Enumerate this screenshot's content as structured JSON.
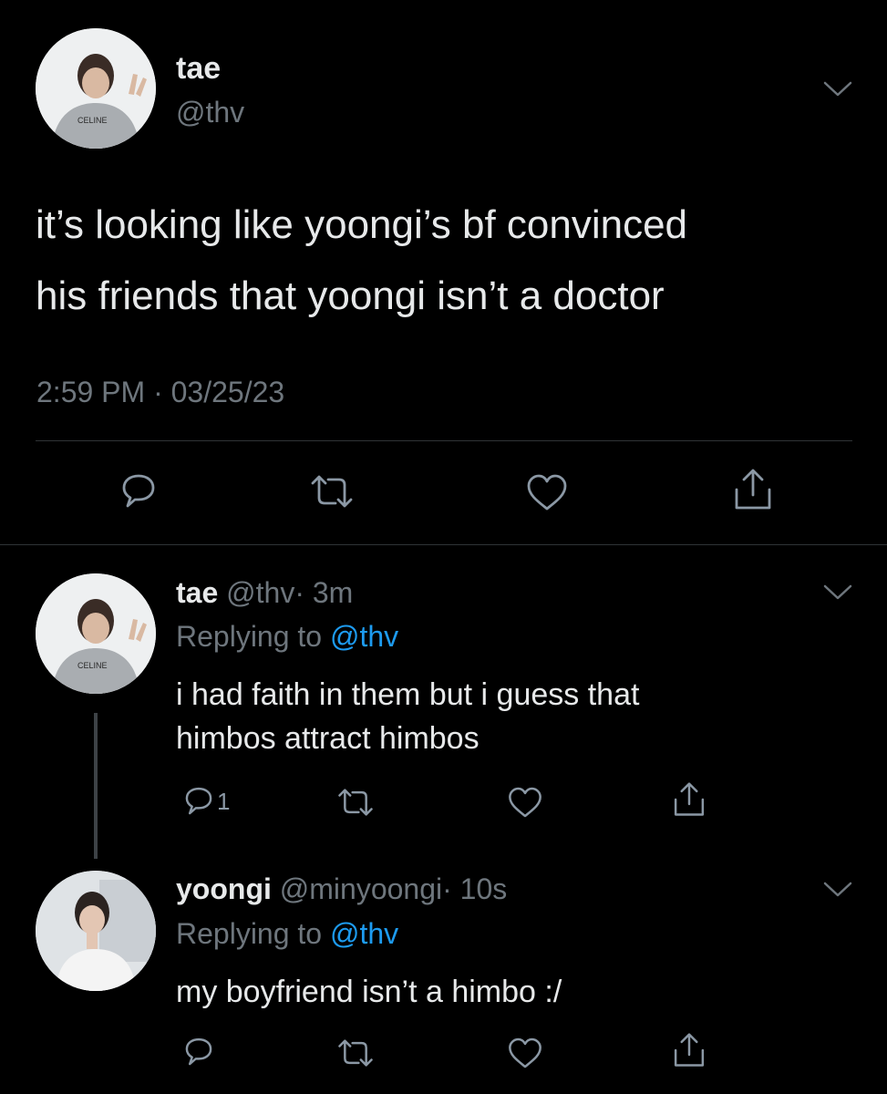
{
  "main_tweet": {
    "display_name": "tae",
    "handle": "@thv",
    "avatar_text": "CELINE",
    "text_line1": "it’s looking like yoongi’s bf convinced",
    "text_line2": "his friends that yoongi isn’t a doctor",
    "timestamp": "2:59 PM · 03/25/23"
  },
  "reply1": {
    "display_name": "tae",
    "handle": "@thv",
    "time": "· 3m",
    "replying_prefix": "Replying to",
    "replying_handle": "@thv",
    "avatar_text": "CELINE",
    "text_line1": "i had faith in them but i guess that",
    "text_line2": "himbos attract himbos",
    "reply_count": "1"
  },
  "reply2": {
    "display_name": "yoongi",
    "handle": "@minyoongi",
    "time": "· 10s",
    "replying_prefix": "Replying to",
    "replying_handle": "@thv",
    "text_line1": "my boyfriend isn’t a himbo :/"
  },
  "icons": [
    "chevron-down-icon",
    "reply-icon",
    "retweet-icon",
    "like-icon",
    "share-icon"
  ],
  "colors": {
    "background": "#000000",
    "text": "#e7e9ea",
    "muted": "#6e767d",
    "link": "#1d9bf0",
    "divider": "#2f3336"
  }
}
